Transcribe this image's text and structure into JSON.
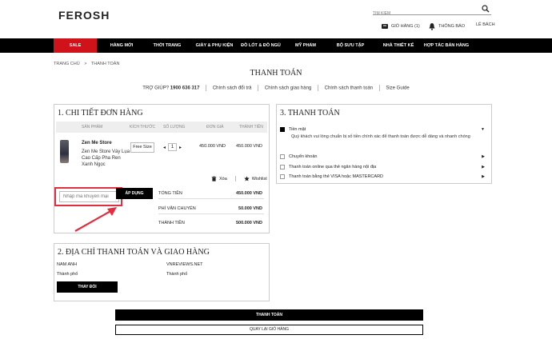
{
  "header": {
    "logo": "FEROSH",
    "search_placeholder": "TÌM KIẾM",
    "cart_label": "GIỎ HÀNG (1)",
    "notify_label": "THÔNG BÁO",
    "location_label": "LÊ BÁCH"
  },
  "nav": [
    "SALE",
    "HÀNG MỚI",
    "THỜI TRANG",
    "GIÀY & PHỤ KIỆN",
    "ĐỒ LÓT & ĐỒ NGỦ",
    "MỸ PHẨM",
    "BỘ SƯU TẬP",
    "NHÀ THIẾT KẾ",
    "HỢP TÁC BÁN HÀNG"
  ],
  "breadcrumb": {
    "home": "TRANG CHỦ",
    "sep": ">",
    "current": "THANH TOÁN"
  },
  "page_title": "THANH TOÁN",
  "help": {
    "label": "TRỢ GIÚP?",
    "phone": "1900 636 317",
    "links": [
      "Chính sách đổi trả",
      "Chính sách giao hàng",
      "Chính sách thanh toán",
      "Size Guide"
    ]
  },
  "order": {
    "title": "1. CHI TIẾT ĐƠN HÀNG",
    "columns": [
      "SẢN PHẨM",
      "KÍCH THƯỚC",
      "SỐ LƯỢNG",
      "ĐƠN GIÁ",
      "THÀNH TIỀN"
    ],
    "item": {
      "name": "Zen Me Store",
      "desc": "Zen Me Store Váy Lụa Cao Cấp Pha Ren Xanh Ngọc",
      "size": "Free Size",
      "qty_minus": "◂",
      "qty": "1",
      "qty_plus": "▸",
      "unit_price": "450.000 VND",
      "total": "450.000 VND"
    },
    "delete_label": "Xóa",
    "wishlist_label": "Wishlist",
    "promo_placeholder": "Nhập mã khuyến mại",
    "apply_label": "ÁP DỤNG",
    "summary": [
      {
        "label": "TỔNG TIỀN",
        "value": "450.000 VND"
      },
      {
        "label": "PHÍ VẬN CHUYỂN",
        "value": "50.000 VND"
      },
      {
        "label": "THÀNH TIỀN",
        "value": "500.000 VND"
      }
    ]
  },
  "address": {
    "title": "2. ĐỊA CHỈ THANH TOÁN VÀ GIAO HÀNG",
    "billing_name": "NAM ANH",
    "billing_city": "Thành phố",
    "shipping_name": "VNREVIEWS.NET",
    "shipping_city": "Thành phố",
    "change_label": "THAY ĐỔI"
  },
  "payment": {
    "title": "3. THANH TOÁN",
    "options": [
      {
        "label": "Tiền mặt",
        "arrow": "▼"
      },
      {
        "label": "Chuyển khoản",
        "arrow": "▶"
      },
      {
        "label": "Thanh toán online qua thẻ ngân hàng nội địa",
        "arrow": "▶"
      },
      {
        "label": "Thanh toán bằng thẻ VISA hoặc MASTERCARD",
        "arrow": "▶"
      }
    ],
    "note": "Quý khách vui lòng chuẩn bị số tiền chính xác để thanh toán được dễ dàng và nhanh chóng"
  },
  "footer_buttons": {
    "pay": "THANH TOÁN",
    "back": "QUAY LẠI GIỎ HÀNG"
  },
  "colors": {
    "sale": "#d0121b",
    "highlight": "#e03040",
    "nav_bg": "#000000"
  }
}
